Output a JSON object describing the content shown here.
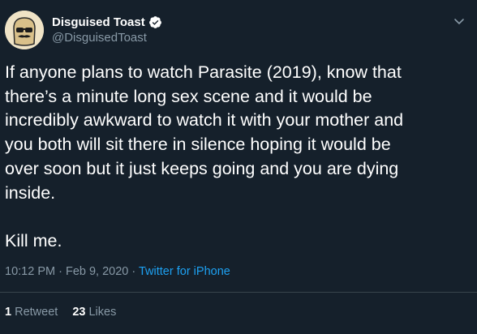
{
  "author": {
    "display_name": "Disguised Toast",
    "handle": "@DisguisedToast",
    "verified_icon": "verified-badge-icon",
    "avatar": "toast-with-sunglasses-and-mustache"
  },
  "tweet": {
    "text": "If anyone plans to watch Parasite (2019), know that\nthere’s a minute long sex scene and it would be\nincredibly awkward to watch it with your mother and\nyou both will sit there in silence hoping it would be\nover soon but it just keeps going and you are dying\ninside.\n\nKill me.",
    "time": "10:12 PM",
    "separator1": " · ",
    "date": "Feb 9, 2020",
    "separator2": " · ",
    "source": "Twitter for iPhone"
  },
  "stats": {
    "retweets_count": "1",
    "retweets_label": "Retweet",
    "likes_count": "23",
    "likes_label": "Likes"
  },
  "colors": {
    "background": "#15202b",
    "secondary_text": "#8899a6",
    "accent": "#1da1f2",
    "divider": "#38444d"
  },
  "icons": {
    "menu": "chevron-down-icon"
  }
}
